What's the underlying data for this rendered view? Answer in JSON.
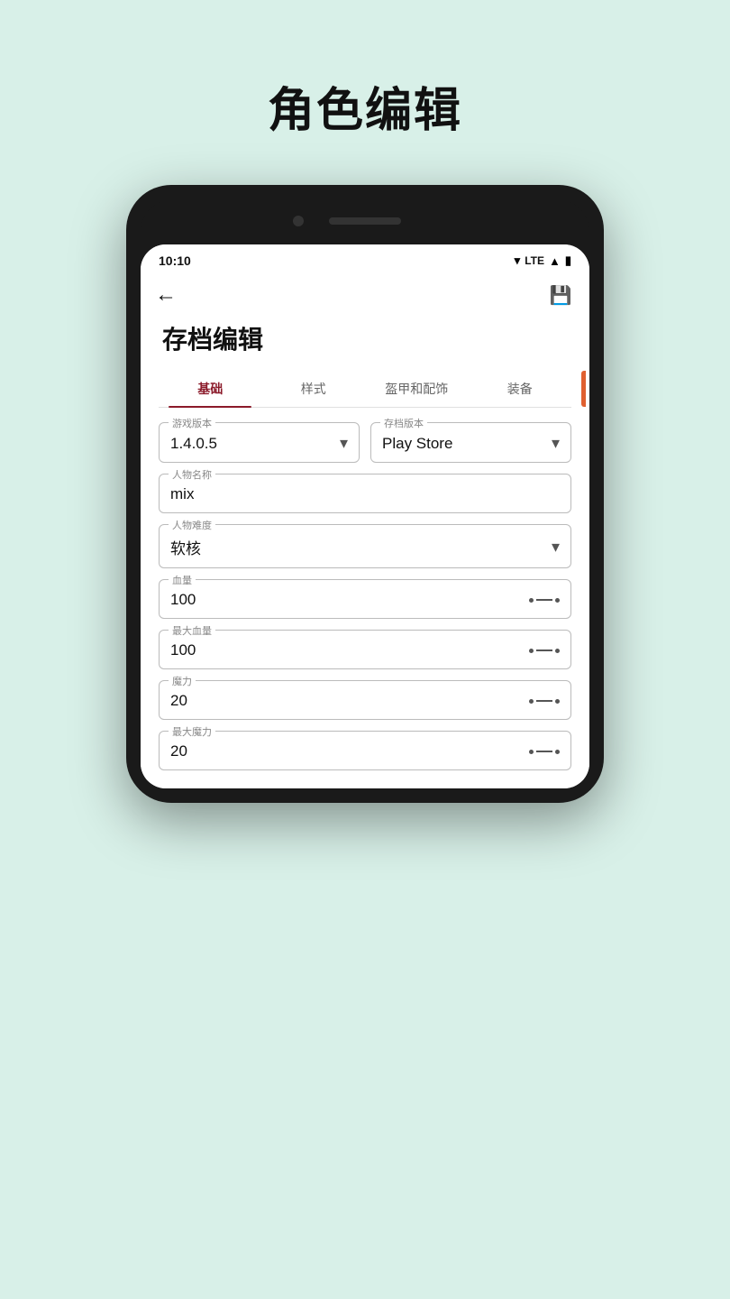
{
  "page": {
    "title": "角色编辑",
    "background": "#d8f0e8"
  },
  "status_bar": {
    "time": "10:10",
    "signal_text": "LTE"
  },
  "app_bar": {
    "back_label": "←",
    "save_label": "💾"
  },
  "form": {
    "section_title": "存档编辑",
    "tabs": [
      {
        "label": "基础",
        "active": true
      },
      {
        "label": "样式",
        "active": false
      },
      {
        "label": "盔甲和配饰",
        "active": false
      },
      {
        "label": "装备",
        "active": false
      }
    ],
    "fields": {
      "game_version": {
        "label": "游戏版本",
        "value": "1.4.0.5"
      },
      "save_version": {
        "label": "存档版本",
        "value": "Play Store"
      },
      "character_name": {
        "label": "人物名称",
        "value": "mix"
      },
      "difficulty": {
        "label": "人物难度",
        "value": "软核"
      },
      "hp": {
        "label": "血量",
        "value": "100"
      },
      "max_hp": {
        "label": "最大血量",
        "value": "100"
      },
      "mp": {
        "label": "魔力",
        "value": "20"
      },
      "max_mp": {
        "label": "最大魔力",
        "value": "20"
      }
    }
  }
}
